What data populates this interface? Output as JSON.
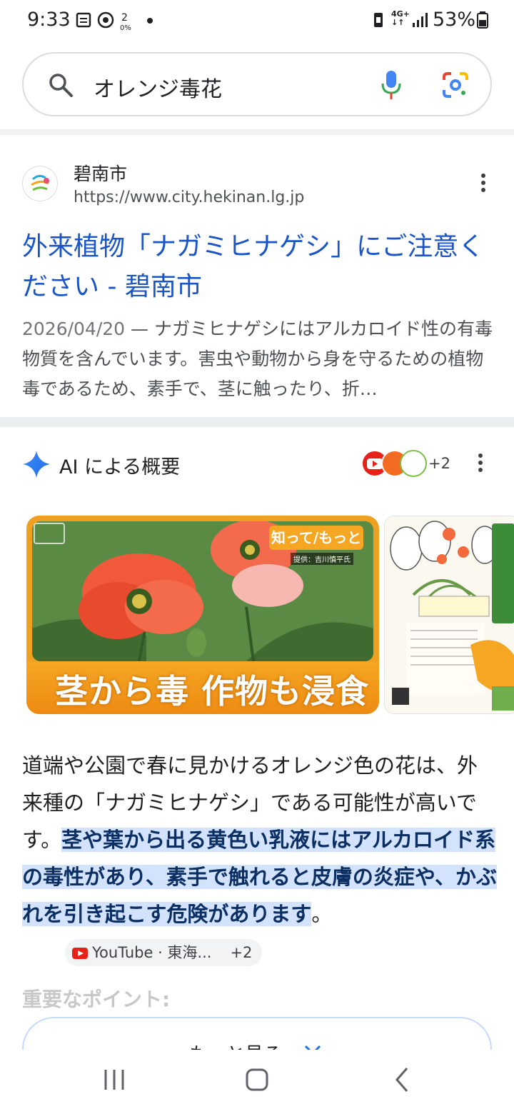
{
  "status_bar": {
    "time": "9:33",
    "network": "4G+",
    "battery": "53%"
  },
  "search": {
    "query": "オレンジ毒花"
  },
  "result": {
    "site_name": "碧南市",
    "url": "https://www.city.hekinan.lg.jp",
    "title": "外来植物「ナガミヒナゲシ」にご注意ください - 碧南市",
    "date": "2026/04/20",
    "snippet": " — ナガミヒナゲシにはアルカロイド性の有毒物質を含んでいます。害虫や動物から身を守るための植物毒であるため、素手で、茎に触ったり、折…"
  },
  "ai_overview": {
    "title": "AI による概要",
    "source_more": "+2",
    "image_caption": "茎から毒 作物も浸食",
    "image_badge": "知って/もっと",
    "body_plain": "道端や公園で春に見かけるオレンジ色の花は、外来種の「ナガミヒナゲシ」である可能性が高いです。",
    "body_highlight": "茎や葉から出る黄色い乳液にはアルカロイド系の毒性があり、素手で触れると皮膚の炎症や、かぶれを引き起こす危険があります",
    "body_end": "。",
    "chip_label": "YouTube · 東海...",
    "chip_more": "+2",
    "faded_heading": "重要なポイント:",
    "more_button": "もっと見る"
  },
  "colors": {
    "link": "#1a55c8",
    "highlight": "#d3e3fd",
    "accent_orange": "#f5a623"
  }
}
